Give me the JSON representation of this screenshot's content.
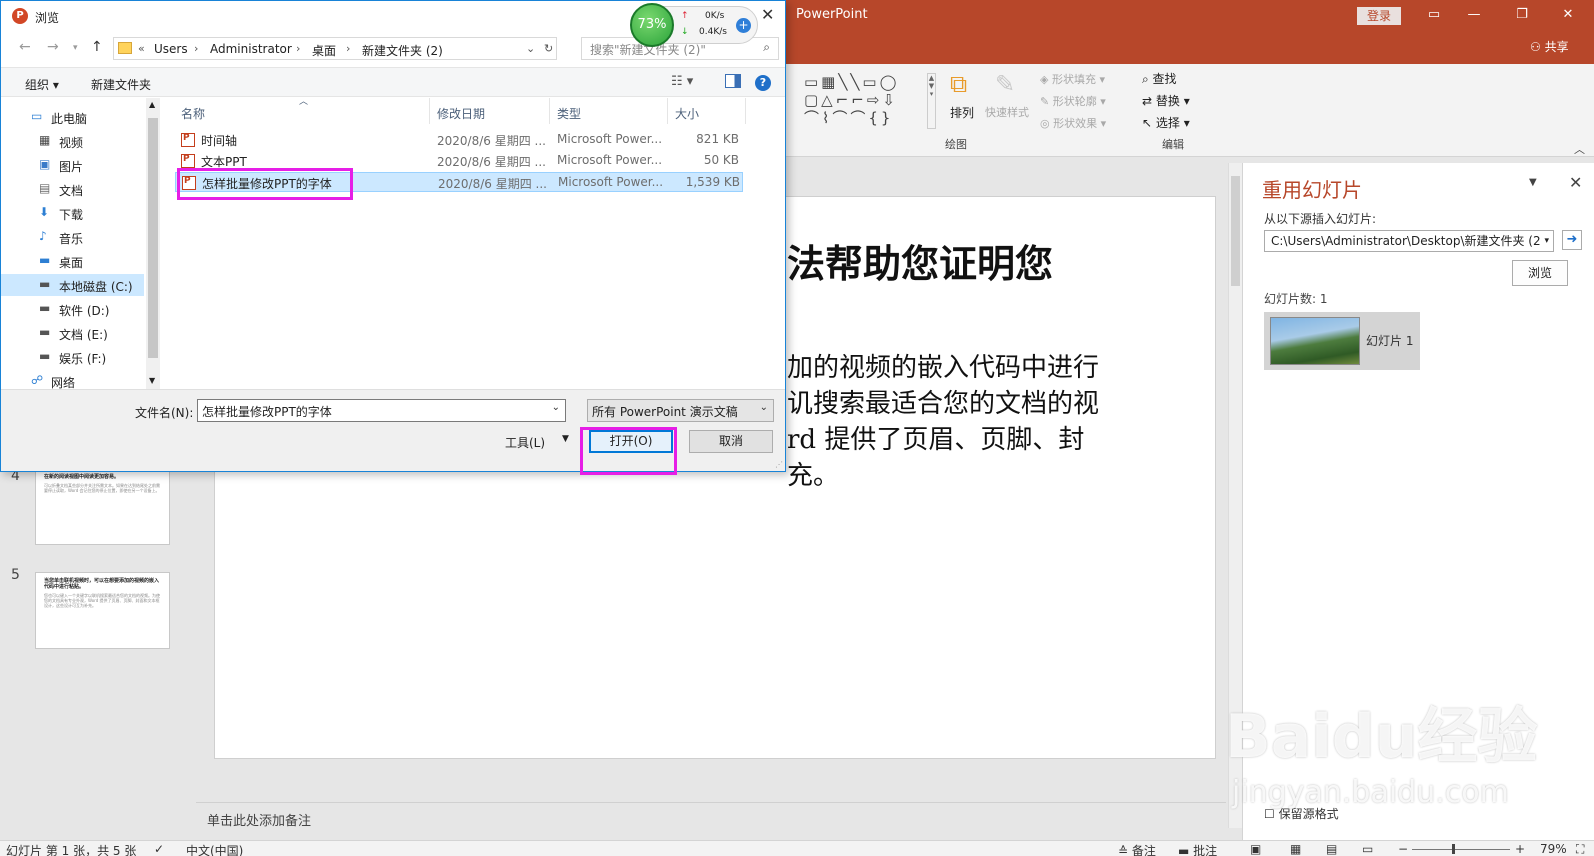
{
  "powerpoint": {
    "app_title": "PowerPoint",
    "login": "登录",
    "share": "共享",
    "ribbon": {
      "shape_fill": "形状填充",
      "shape_outline": "形状轮廓",
      "shape_effect": "形状效果",
      "arrange": "排列",
      "quick_styles": "快速样式",
      "drawing_group": "绘图",
      "find": "查找",
      "replace": "替换",
      "select": "选择",
      "editing_group": "编辑"
    },
    "slide": {
      "title_fragment": "法帮助您证明您",
      "body_lines": [
        "加的视频的嵌入代码中进行",
        "讥搜索最适合您的文档的视",
        "rd 提供了页眉、页脚、封",
        "充。"
      ]
    },
    "thumbnails": [
      {
        "number": "4",
        "title": "在新的阅读视图中阅读更加容易。",
        "body": "可以折叠文档某些部分并关注所需文本。如果在达到结尾处之前需要停止读取，Word 会记住您的停止位置，即使在另一个设备上。"
      },
      {
        "number": "5",
        "title": "当您单击联机视频时，可以在想要添加的视频的嵌入代码中进行粘贴。",
        "body": "您也可以键入一个关键字以联机搜索最适合您的文档的视频。为使您的文档具有专业外观，Word 提供了页眉、页脚、封面和文本框设计，这些设计可互为补充。"
      }
    ],
    "notes_placeholder": "单击此处添加备注",
    "reuse_pane": {
      "title": "重用幻灯片",
      "insert_label": "从以下源插入幻灯片:",
      "path": "C:\\Users\\Administrator\\Desktop\\新建文件夹 (2",
      "browse": "浏览",
      "count": "幻灯片数: 1",
      "slide_label": "幻灯片 1",
      "keep_format": "保留源格式"
    },
    "status": {
      "slide_info": "幻灯片 第 1 张，共 5 张",
      "language": "中文(中国)",
      "notes": "备注",
      "comments": "批注",
      "zoom": "79%"
    }
  },
  "dialog": {
    "title": "浏览",
    "breadcrumb": [
      "Users",
      "Administrator",
      "桌面",
      "新建文件夹 (2)"
    ],
    "search_placeholder": "搜索\"新建文件夹 (2)\"",
    "organize": "组织",
    "new_folder": "新建文件夹",
    "nav_tree": [
      {
        "label": "此电脑",
        "icon": "computer-icon"
      },
      {
        "label": "视频",
        "icon": "video-folder-icon"
      },
      {
        "label": "图片",
        "icon": "pictures-folder-icon"
      },
      {
        "label": "文档",
        "icon": "documents-folder-icon"
      },
      {
        "label": "下载",
        "icon": "download-icon"
      },
      {
        "label": "音乐",
        "icon": "music-icon"
      },
      {
        "label": "桌面",
        "icon": "desktop-folder-icon"
      },
      {
        "label": "本地磁盘 (C:)",
        "icon": "drive-icon",
        "selected": true
      },
      {
        "label": "软件 (D:)",
        "icon": "drive-icon"
      },
      {
        "label": "文档 (E:)",
        "icon": "drive-icon"
      },
      {
        "label": "娱乐 (F:)",
        "icon": "drive-icon"
      },
      {
        "label": "网络",
        "icon": "network-icon"
      }
    ],
    "columns": {
      "name": "名称",
      "date": "修改日期",
      "type": "类型",
      "size": "大小"
    },
    "files": [
      {
        "name": "时间轴",
        "date": "2020/8/6 星期四 ...",
        "type": "Microsoft Power...",
        "size": "821 KB",
        "selected": false
      },
      {
        "name": "文本PPT",
        "date": "2020/8/6 星期四 ...",
        "type": "Microsoft Power...",
        "size": "50 KB",
        "selected": false
      },
      {
        "name": "怎样批量修改PPT的字体",
        "date": "2020/8/6 星期四 ...",
        "type": "Microsoft Power...",
        "size": "1,539 KB",
        "selected": true
      }
    ],
    "filename_label": "文件名(N):",
    "filename_value": "怎样批量修改PPT的字体",
    "filetype": "所有 PowerPoint 演示文稿",
    "tools": "工具(L)",
    "open": "打开(O)",
    "cancel": "取消"
  },
  "net_monitor": {
    "percent": "73%",
    "up": "0K/s",
    "down": "0.4K/s"
  },
  "watermark": {
    "main": "Baidu经验",
    "sub": "jingyan.baidu.com"
  },
  "colors": {
    "ppt_accent": "#b7472a",
    "highlight": "#e61ee6",
    "selection": "#cce8ff"
  }
}
